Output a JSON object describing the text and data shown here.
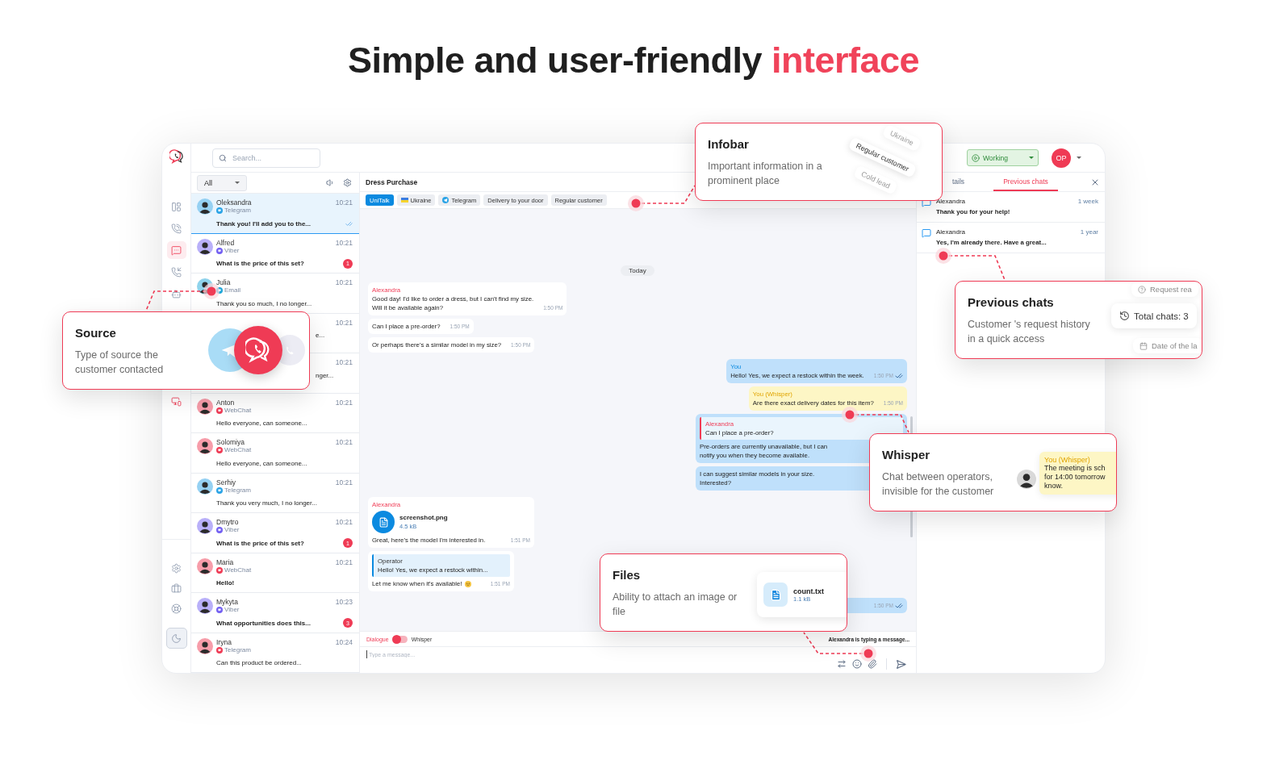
{
  "heading": {
    "text": "Simple and user-friendly",
    "accent": "interface"
  },
  "rail": {
    "top": [
      {
        "kind": "layout",
        "selected": false
      },
      {
        "kind": "calls",
        "selected": false
      },
      {
        "kind": "chats",
        "selected": true
      },
      {
        "kind": "contacts",
        "selected": false
      },
      {
        "kind": "bot",
        "selected": false
      },
      {
        "kind": "devices",
        "selected": false
      }
    ],
    "bottom": [
      {
        "kind": "settings",
        "selected": false
      },
      {
        "kind": "briefcase",
        "selected": false
      },
      {
        "kind": "support",
        "selected": false
      },
      {
        "kind": "theme",
        "selected": true
      }
    ]
  },
  "search": {
    "placeholder": "Search..."
  },
  "status": {
    "label": "Working"
  },
  "operator": {
    "initials": "OP"
  },
  "chat_list": {
    "filter": "All",
    "items": [
      {
        "kind": "chat",
        "name": "Oleksandra",
        "source": "Telegram",
        "color": "#2aa3e6",
        "time": "10:21",
        "preview": "Thank you! I'll add you to the...",
        "unread": true,
        "read": true,
        "selected": true
      },
      {
        "kind": "chat",
        "name": "Alfred",
        "source": "Viber",
        "color": "#7360f2",
        "time": "10:21",
        "preview": "What is the price of this set?",
        "unread": true,
        "read": false,
        "badge": "1",
        "selected": false
      },
      {
        "kind": "chat",
        "name": "Julia",
        "source": "Email",
        "color": "#1fa6d8",
        "time": "10:21",
        "preview": "Thank you so much, I no longer...",
        "unread": false,
        "read": false,
        "selected": false
      },
      {
        "kind": "covered",
        "time": "10:21",
        "preview": "e...",
        "selected": false
      },
      {
        "kind": "covered",
        "time": "10:21",
        "preview": "nger...",
        "selected": false
      },
      {
        "kind": "chat",
        "name": "Anton",
        "source": "WebChat",
        "color": "#ef3b55",
        "time": "10:21",
        "preview": "Hello everyone, can someone...",
        "unread": false,
        "read": false,
        "selected": false
      },
      {
        "kind": "chat",
        "name": "Solomiya",
        "source": "WebChat",
        "color": "#ef3b55",
        "time": "10:21",
        "preview": "Hello everyone, can someone...",
        "unread": false,
        "read": false,
        "selected": false
      },
      {
        "kind": "chat",
        "name": "Serhiy",
        "source": "Telegram",
        "color": "#2aa3e6",
        "time": "10:21",
        "preview": "Thank you very much, I no longer...",
        "unread": false,
        "read": false,
        "selected": false
      },
      {
        "kind": "chat",
        "name": "Dmytro",
        "source": "Viber",
        "color": "#7360f2",
        "time": "10:21",
        "preview": "What is the price of this set?",
        "unread": true,
        "read": false,
        "badge": "1",
        "selected": false
      },
      {
        "kind": "chat",
        "name": "Maria",
        "source": "WebChat",
        "color": "#ef3b55",
        "time": "10:21",
        "preview": "Hello!",
        "unread": true,
        "read": false,
        "selected": false
      },
      {
        "kind": "chat",
        "name": "Mykyta",
        "source": "Viber",
        "color": "#7360f2",
        "time": "10:23",
        "preview": "What opportunities does this...",
        "unread": true,
        "read": false,
        "badge": "3",
        "selected": false
      },
      {
        "kind": "chat",
        "name": "Iryna",
        "source": "Telegram",
        "color": "#ef3b55",
        "time": "10:24",
        "preview": "Can this product be ordered...",
        "unread": false,
        "read": false,
        "selected": false
      }
    ]
  },
  "chat": {
    "title": "Dress Purchase",
    "tags": [
      {
        "kind": "brand",
        "label": "UniTalk"
      },
      {
        "kind": "flag",
        "label": "Ukraine"
      },
      {
        "kind": "telegram",
        "label": "Telegram"
      },
      {
        "kind": "plain",
        "label": "Delivery to your door"
      },
      {
        "kind": "plain",
        "label": "Regular customer"
      }
    ],
    "messages": [
      {
        "kind": "date",
        "text": "Today"
      },
      {
        "kind": "incoming",
        "author": "Alexandra",
        "text": "Good day! I'd like to order a dress, but I can't find my size.\nWill it be available again?",
        "time": "1:50 PM"
      },
      {
        "kind": "incoming",
        "text": "Can I place a pre-order?",
        "time": "1:50 PM"
      },
      {
        "kind": "incoming",
        "text": "Or perhaps there's a similar model in my size?",
        "time": "1:50 PM"
      },
      {
        "kind": "outgoing",
        "author": "You",
        "text": "Hello! Yes, we expect a restock within the week.",
        "time": "1:50 PM",
        "read": true
      },
      {
        "kind": "whisper",
        "author": "You (Whisper)",
        "text": "Are there exact delivery dates for this item?",
        "time": "1:50 PM"
      },
      {
        "kind": "reply",
        "quote_author": "Alexandra",
        "quote_text": "Can I place a pre-order?",
        "text": "Pre-orders are currently unavailable, but I can\nnotify you when they become available."
      },
      {
        "kind": "outgoing",
        "text": "I can suggest similar models in your size.\nInterested?"
      },
      {
        "kind": "file",
        "author": "Alexandra",
        "file_name": "screenshot.png",
        "file_size": "4.5 kB",
        "text": "Great, here's the model I'm interested in.",
        "time": "1:51 PM"
      },
      {
        "kind": "quoted",
        "quote_author": "Operator",
        "quote_text": "Hello! Yes, we expect a restock within...",
        "text": "Let me know when it's available!",
        "time": "1:51 PM"
      },
      {
        "kind": "outgoing",
        "time": "1:50 PM",
        "read": true
      }
    ],
    "composer": {
      "dialogue": "Dialogue",
      "whisper_label": "Whisper",
      "whisper": false,
      "typing": "Alexandra is typing a message...",
      "placeholder": "Type a message..."
    }
  },
  "right_panel": {
    "tabs": [
      {
        "label": "tails",
        "selected": false
      },
      {
        "label": "Previous chats",
        "selected": true
      }
    ],
    "previous_chats": [
      {
        "name": "Alexandra",
        "time": "1 week",
        "text": "Thank you for your help!"
      },
      {
        "name": "Alexandra",
        "time": "1 year",
        "text": "Yes, I'm already there. Have a great..."
      }
    ]
  },
  "callouts": [
    {
      "kind": "infobar",
      "title": "Infobar",
      "description": "Important information in a prominent place",
      "tags": [
        "Ukraine",
        "Regular customer",
        "Cold lead"
      ]
    },
    {
      "kind": "previous",
      "title": "Previous chats",
      "description": "Customer 's request history in a quick access",
      "chips": [
        {
          "kind": "help",
          "label": "Request rea",
          "faded": true
        },
        {
          "kind": "history",
          "label": "Total chats: 3",
          "faded": false
        },
        {
          "kind": "calendar",
          "label": "Date of the la",
          "faded": true
        }
      ]
    },
    {
      "kind": "source",
      "title": "Source",
      "description": "Type of source the customer contacted"
    },
    {
      "kind": "whisper",
      "title": "Whisper",
      "description": "Chat between operators, invisible for the customer",
      "author": "You (Whisper)",
      "text": "The meeting is sch\nfor 14:00 tomorrow\nknow."
    },
    {
      "kind": "files",
      "title": "Files",
      "description": "Ability to attach an image or file",
      "file_name": "count.txt",
      "file_size": "1.1 kB"
    }
  ]
}
